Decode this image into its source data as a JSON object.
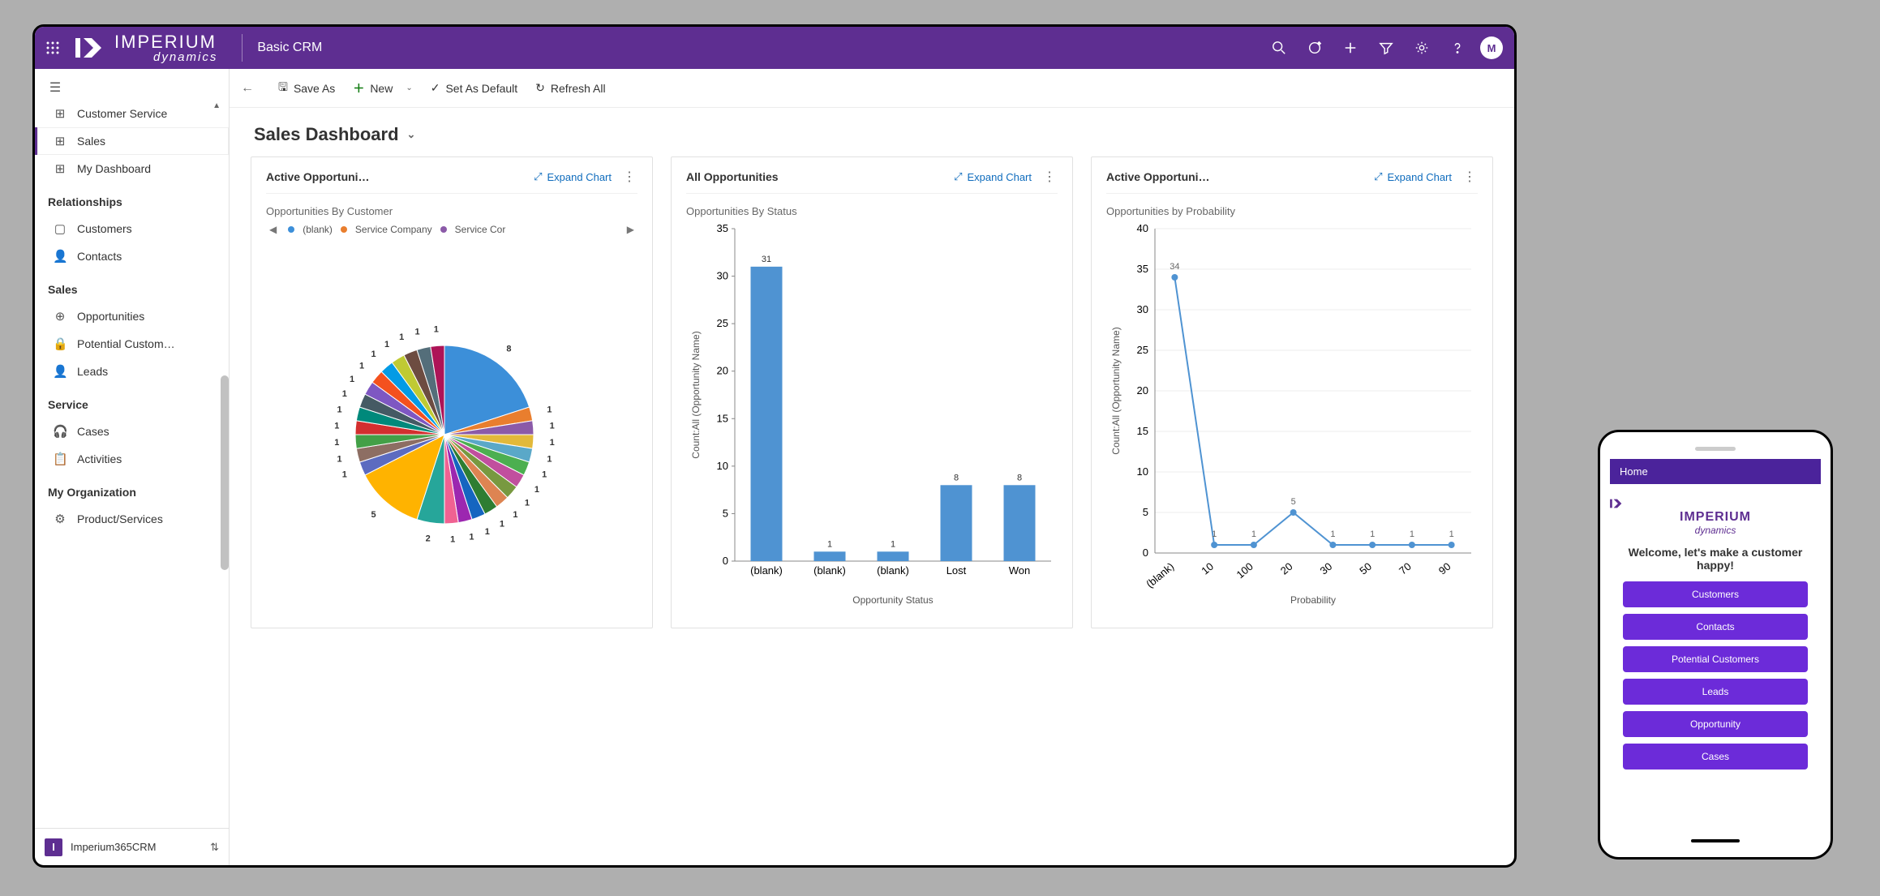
{
  "topbar": {
    "app_name": "Basic CRM",
    "avatar_initial": "M"
  },
  "sidebar": {
    "groups": [
      {
        "title": null,
        "items": [
          {
            "icon": "grid",
            "label": "Customer Service",
            "selected": false
          },
          {
            "icon": "grid",
            "label": "Sales",
            "selected": true
          },
          {
            "icon": "grid",
            "label": "My Dashboard",
            "selected": false
          }
        ]
      },
      {
        "title": "Relationships",
        "items": [
          {
            "icon": "box",
            "label": "Customers"
          },
          {
            "icon": "person",
            "label": "Contacts"
          }
        ]
      },
      {
        "title": "Sales",
        "items": [
          {
            "icon": "target",
            "label": "Opportunities"
          },
          {
            "icon": "lock",
            "label": "Potential Custom…"
          },
          {
            "icon": "person",
            "label": "Leads"
          }
        ]
      },
      {
        "title": "Service",
        "items": [
          {
            "icon": "headset",
            "label": "Cases"
          },
          {
            "icon": "clipboard",
            "label": "Activities"
          }
        ]
      },
      {
        "title": "My Organization",
        "items": [
          {
            "icon": "gear",
            "label": "Product/Services"
          }
        ]
      }
    ],
    "app_switcher_label": "Imperium365CRM",
    "app_switcher_initial": "I"
  },
  "commandbar": {
    "save_as": "Save As",
    "new": "New",
    "set_default": "Set As Default",
    "refresh": "Refresh All"
  },
  "page": {
    "title": "Sales Dashboard"
  },
  "cards": {
    "c1": {
      "title": "Active Opportuni…",
      "expand": "Expand Chart",
      "subtitle": "Opportunities By Customer",
      "legend": [
        "(blank)",
        "Service Company",
        "Service Cor"
      ]
    },
    "c2": {
      "title": "All Opportunities",
      "expand": "Expand Chart",
      "subtitle": "Opportunities By Status",
      "xaxis": "Opportunity Status",
      "yaxis": "Count:All (Opportunity Name)"
    },
    "c3": {
      "title": "Active Opportuni…",
      "expand": "Expand Chart",
      "subtitle": "Opportunities by Probability",
      "xaxis": "Probability",
      "yaxis": "Count:All (Opportunity Name)"
    }
  },
  "mobile": {
    "bar": "Home",
    "welcome": "Welcome, let's make a customer happy!",
    "buttons": [
      "Customers",
      "Contacts",
      "Potential Customers",
      "Leads",
      "Opportunity",
      "Cases"
    ]
  },
  "chart_data": [
    {
      "type": "pie",
      "id": "opportunities-by-customer",
      "title": "Opportunities By Customer",
      "legend": [
        "(blank)",
        "Service Company",
        "Service Cor"
      ],
      "slices": [
        8,
        1,
        1,
        1,
        1,
        1,
        1,
        1,
        1,
        1,
        1,
        1,
        1,
        2,
        5,
        1,
        1,
        1,
        1,
        1,
        1,
        1,
        1,
        1,
        1,
        1,
        1,
        1
      ]
    },
    {
      "type": "bar",
      "id": "opportunities-by-status",
      "title": "Opportunities By Status",
      "categories": [
        "(blank)",
        "(blank)",
        "(blank)",
        "Lost",
        "Won"
      ],
      "values": [
        31,
        1,
        1,
        8,
        8
      ],
      "xlabel": "Opportunity Status",
      "ylabel": "Count:All (Opportunity Name)",
      "ylim": [
        0,
        35
      ],
      "yticks": [
        0,
        5,
        10,
        15,
        20,
        25,
        30,
        35
      ]
    },
    {
      "type": "line",
      "id": "opportunities-by-probability",
      "title": "Opportunities by Probability",
      "categories": [
        "(blank)",
        "10",
        "100",
        "20",
        "30",
        "50",
        "70",
        "90"
      ],
      "values": [
        34,
        1,
        1,
        5,
        1,
        1,
        1,
        1
      ],
      "xlabel": "Probability",
      "ylabel": "Count:All (Opportunity Name)",
      "ylim": [
        0,
        40
      ],
      "yticks": [
        0,
        5,
        10,
        15,
        20,
        25,
        30,
        35,
        40
      ]
    }
  ]
}
